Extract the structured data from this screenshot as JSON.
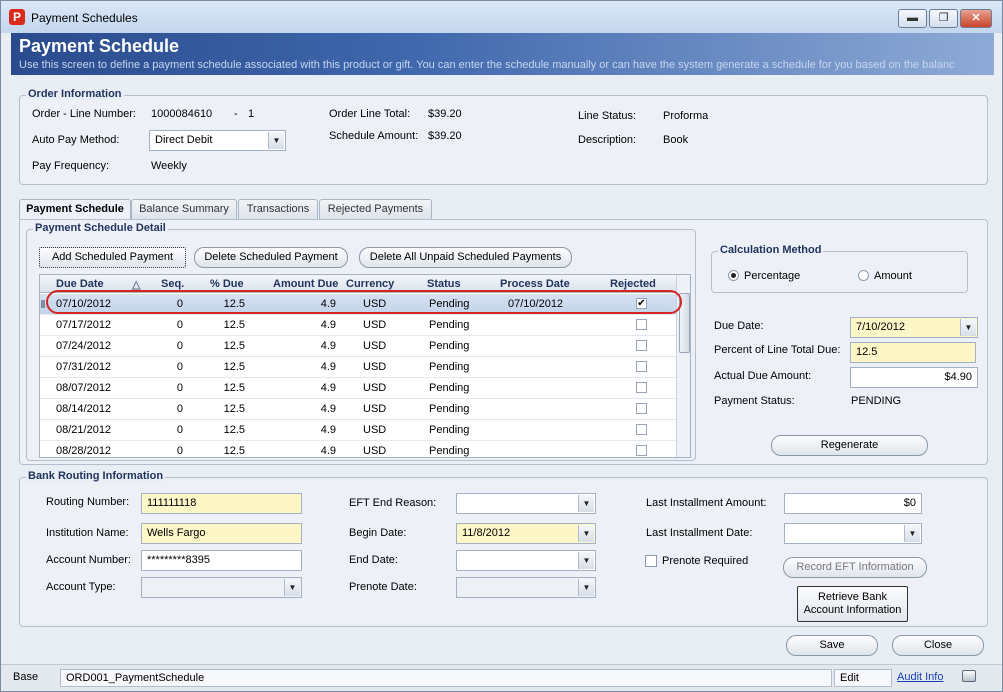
{
  "window": {
    "title": "Payment Schedules",
    "app_icon": "P",
    "minimize": "▬",
    "restore": "❐",
    "close": "✕"
  },
  "header": {
    "title": "Payment Schedule",
    "subtitle": "Use this screen to define a payment schedule associated with this product or gift. You can enter the schedule manually or can have the system generate a schedule for you based on the balanc"
  },
  "order": {
    "group_title": "Order Information",
    "line_label": "Order - Line Number:",
    "order_no": "1000084610",
    "dash": "-",
    "line_no": "1",
    "autopay_label": "Auto Pay Method:",
    "autopay_value": "Direct Debit",
    "freq_label": "Pay Frequency:",
    "freq_value": "Weekly",
    "total_label": "Order Line Total:",
    "total_value": "$39.20",
    "sched_label": "Schedule Amount:",
    "sched_value": "$39.20",
    "status_label": "Line Status:",
    "status_value": "Proforma",
    "desc_label": "Description:",
    "desc_value": "Book"
  },
  "tabs": [
    "Payment Schedule",
    "Balance Summary",
    "Transactions",
    "Rejected Payments"
  ],
  "detail": {
    "group_title": "Payment Schedule Detail",
    "add_btn": "Add Scheduled Payment",
    "delete_btn": "Delete Scheduled Payment",
    "delete_all_btn": "Delete All Unpaid Scheduled Payments",
    "columns": [
      "Due Date",
      "Seq.",
      "% Due",
      "Amount Due",
      "Currency",
      "Status",
      "Process Date",
      "Rejected"
    ],
    "sort_indicator": "△",
    "rows": [
      {
        "due": "07/10/2012",
        "seq": "0",
        "pct": "12.5",
        "amt": "4.9",
        "cur": "USD",
        "status": "Pending",
        "process": "07/10/2012",
        "rejected": "✔"
      },
      {
        "due": "07/17/2012",
        "seq": "0",
        "pct": "12.5",
        "amt": "4.9",
        "cur": "USD",
        "status": "Pending",
        "process": "",
        "rejected": ""
      },
      {
        "due": "07/24/2012",
        "seq": "0",
        "pct": "12.5",
        "amt": "4.9",
        "cur": "USD",
        "status": "Pending",
        "process": "",
        "rejected": ""
      },
      {
        "due": "07/31/2012",
        "seq": "0",
        "pct": "12.5",
        "amt": "4.9",
        "cur": "USD",
        "status": "Pending",
        "process": "",
        "rejected": ""
      },
      {
        "due": "08/07/2012",
        "seq": "0",
        "pct": "12.5",
        "amt": "4.9",
        "cur": "USD",
        "status": "Pending",
        "process": "",
        "rejected": ""
      },
      {
        "due": "08/14/2012",
        "seq": "0",
        "pct": "12.5",
        "amt": "4.9",
        "cur": "USD",
        "status": "Pending",
        "process": "",
        "rejected": ""
      },
      {
        "due": "08/21/2012",
        "seq": "0",
        "pct": "12.5",
        "amt": "4.9",
        "cur": "USD",
        "status": "Pending",
        "process": "",
        "rejected": ""
      },
      {
        "due": "08/28/2012",
        "seq": "0",
        "pct": "12.5",
        "amt": "4.9",
        "cur": "USD",
        "status": "Pending",
        "process": "",
        "rejected": ""
      }
    ]
  },
  "calc": {
    "group_title": "Calculation Method",
    "percentage": "Percentage",
    "amount": "Amount",
    "due_date_label": "Due Date:",
    "due_date_value": "7/10/2012",
    "pct_label": "Percent of Line Total Due:",
    "pct_value": "12.5",
    "actual_label": "Actual Due Amount:",
    "actual_value": "$4.90",
    "status_label": "Payment Status:",
    "status_value": "PENDING",
    "regenerate": "Regenerate"
  },
  "bank": {
    "group_title": "Bank Routing Information",
    "routing_label": "Routing Number:",
    "routing_value": "111111118",
    "inst_label": "Institution Name:",
    "inst_value": "Wells Fargo",
    "acct_label": "Account Number:",
    "acct_value": "*********8395",
    "type_label": "Account Type:",
    "type_value": "",
    "eft_label": "EFT End Reason:",
    "eft_value": "",
    "begin_label": "Begin Date:",
    "begin_value": "11/8/2012",
    "end_label": "End Date:",
    "end_value": "",
    "prenote_date_label": "Prenote Date:",
    "prenote_date_value": "",
    "last_amt_label": "Last Installment Amount:",
    "last_amt_value": "$0",
    "last_date_label": "Last Installment Date:",
    "last_date_value": "",
    "prenote_req": "Prenote Required",
    "record_eft": "Record EFT Information",
    "retrieve_line1": "Retrieve Bank",
    "retrieve_line2": "Account Information"
  },
  "footer": {
    "save": "Save",
    "close": "Close"
  },
  "statusbar": {
    "base": "Base",
    "screen": "ORD001_PaymentSchedule",
    "mode": "Edit",
    "audit": "Audit Info"
  },
  "colors": {
    "header": "#2a4b8d",
    "highlight": "#d42424",
    "required": "#fdf6c6",
    "group_title": "#21345e"
  }
}
